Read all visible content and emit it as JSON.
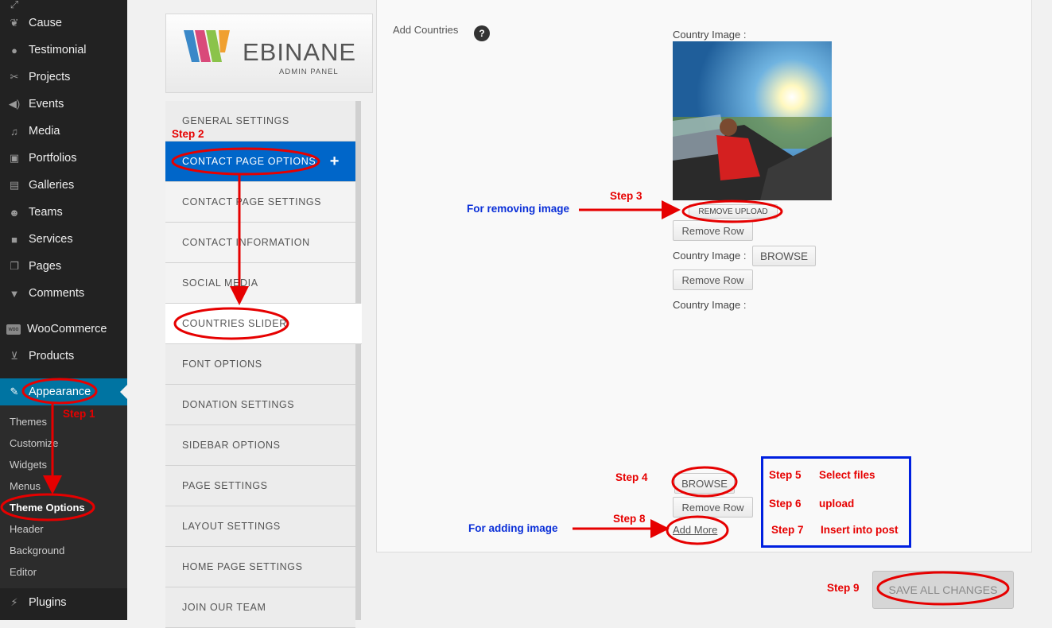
{
  "wp_menu": {
    "items": [
      {
        "label": "Cause",
        "icon": "leaf-icon"
      },
      {
        "label": "Testimonial",
        "icon": "speech-bubble-icon"
      },
      {
        "label": "Projects",
        "icon": "scissors-icon"
      },
      {
        "label": "Events",
        "icon": "megaphone-icon"
      },
      {
        "label": "Media",
        "icon": "camera-music-icon"
      },
      {
        "label": "Portfolios",
        "icon": "image-icon"
      },
      {
        "label": "Galleries",
        "icon": "film-icon"
      },
      {
        "label": "Teams",
        "icon": "users-icon"
      },
      {
        "label": "Services",
        "icon": "briefcase-icon"
      },
      {
        "label": "Pages",
        "icon": "pages-icon"
      },
      {
        "label": "Comments",
        "icon": "comment-icon"
      },
      {
        "label": "WooCommerce",
        "icon": "woo-icon"
      },
      {
        "label": "Products",
        "icon": "cart-icon"
      },
      {
        "label": "Appearance",
        "icon": "brush-icon"
      },
      {
        "label": "Plugins",
        "icon": "plug-icon"
      }
    ],
    "appearance_submenu": [
      "Themes",
      "Customize",
      "Widgets",
      "Menus",
      "Theme Options",
      "Header",
      "Background",
      "Editor"
    ]
  },
  "logo": {
    "brand": "EBINANE",
    "subtitle": "ADMIN PANEL"
  },
  "nav": [
    "GENERAL SETTINGS",
    "CONTACT PAGE OPTIONS",
    "CONTACT PAGE SETTINGS",
    "CONTACT INFORMATION",
    "SOCIAL MEDIA",
    "COUNTRIES SLIDER",
    "FONT OPTIONS",
    "DONATION SETTINGS",
    "SIDEBAR OPTIONS",
    "PAGE SETTINGS",
    "LAYOUT SETTINGS",
    "HOME PAGE SETTINGS",
    "JOIN OUR TEAM"
  ],
  "nav_plus": "+",
  "content": {
    "add_countries": "Add Countries",
    "help": "?",
    "country_image_label": "Country Image :",
    "remove_upload": "REMOVE UPLOAD",
    "remove_row": "Remove Row",
    "browse": "BROWSE",
    "add_more": "Add More",
    "save_all": "SAVE ALL CHANGES"
  },
  "annotations": {
    "step1": "Step 1",
    "step2": "Step 2",
    "step3": "Step 3",
    "step4": "Step 4",
    "step5": "Step 5",
    "step6": "Step 6",
    "step7": "Step 7",
    "step8": "Step 8",
    "step9": "Step 9",
    "select_files": "Select files",
    "upload": "upload",
    "insert_into_post": "Insert into post",
    "for_removing": "For removing image",
    "for_adding": "For adding image"
  },
  "colors": {
    "wp_dark": "#222222",
    "wp_blue": "#0074a2",
    "nav_active": "#0066c9",
    "annotation_red": "#e60000",
    "annotation_blue": "#0020e0"
  }
}
